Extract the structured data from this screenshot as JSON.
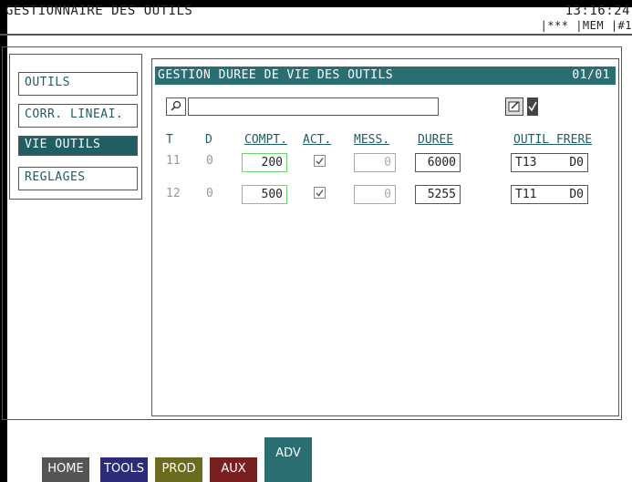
{
  "header": {
    "app_title": "GESTIONNAIRE DES OUTILS",
    "clock": "13:16:24",
    "status": "|*** |MEM |#1"
  },
  "sidebar": {
    "items": [
      {
        "label": "OUTILS",
        "active": false
      },
      {
        "label": "CORR. LINEAI.",
        "active": false
      },
      {
        "label": "VIE OUTILS",
        "active": true
      },
      {
        "label": "REGLAGES",
        "active": false
      }
    ]
  },
  "content": {
    "title": "GESTION DUREE DE VIE DES OUTILS",
    "page": "01/01",
    "search": {
      "value": "",
      "placeholder": ""
    },
    "columns": {
      "t": "T",
      "d": "D",
      "compt": "COMPT.",
      "act": "ACT.",
      "mess": "MESS.",
      "duree": "DUREE",
      "outil_frere": "OUTIL FRERE"
    },
    "rows": [
      {
        "t": "11",
        "d": "0",
        "compt": "200",
        "act": true,
        "mess": "0",
        "duree": "6000",
        "frere_t": "T13",
        "frere_d": "D0"
      },
      {
        "t": "12",
        "d": "0",
        "compt": "500",
        "act": true,
        "mess": "0",
        "duree": "5255",
        "frere_t": "T11",
        "frere_d": "D0"
      }
    ]
  },
  "footer": {
    "nav": [
      {
        "label": "HOME",
        "color": "#555555"
      },
      {
        "label": "TOOLS",
        "color": "#2b2b7a"
      },
      {
        "label": "PROD",
        "color": "#6b6b1f"
      },
      {
        "label": "AUX",
        "color": "#7a1f1f"
      }
    ],
    "active_tab": {
      "label": "ADV",
      "color": "#2a6e72"
    }
  },
  "colors": {
    "accent": "#2a6e72",
    "editable_border": "#6dd46d"
  }
}
